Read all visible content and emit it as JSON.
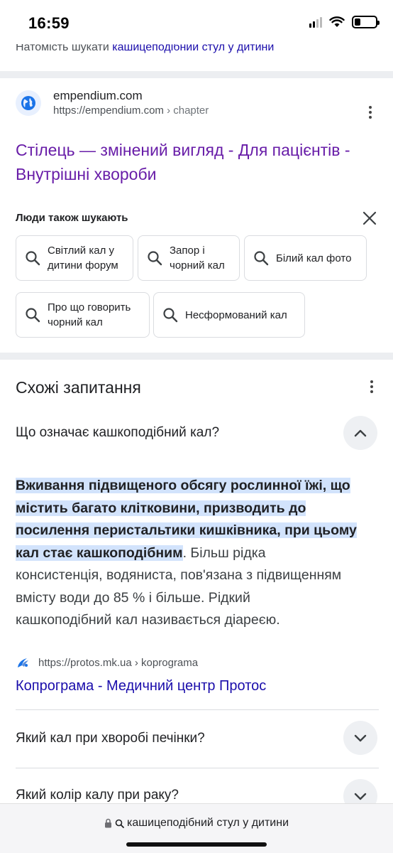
{
  "status_bar": {
    "time": "16:59"
  },
  "instead_search": {
    "prefix": "Натомість шукати",
    "link": "кашицеподібний стул у дитини"
  },
  "result": {
    "site_name": "empendium.com",
    "url": "https://empendium.com",
    "crumb": "› chapter",
    "title": "Стілець — змінений вигляд - Для пацієнтів - Внутрішні хвороби"
  },
  "people_also_search": {
    "heading": "Люди також шукають",
    "chips": [
      {
        "line1": "Світлий кал у",
        "line2": "дитини форум"
      },
      {
        "line1": "Запор і",
        "line2": "чорний кал"
      },
      {
        "line1": "Білий кал фото",
        "line2": ""
      },
      {
        "line1": "Про що говорить",
        "line2": "чорний кал"
      },
      {
        "line1": "Несформований кал",
        "line2": ""
      }
    ]
  },
  "related_questions": {
    "heading": "Схожі запитання",
    "q1": "Що означає кашкоподібний кал?",
    "answer_highlight_l1": "Вживання підвищеного обсягу рослинної їжі, що",
    "answer_highlight_l2": "містить багато клітковини, призводить до",
    "answer_highlight_l3": "посилення перистальтики кишківника, при цьому",
    "answer_highlight_l4": "кал стає кашкоподібним",
    "answer_rest_l4": ". Більш рідка",
    "answer_l5": "консистенція, водяниста, пов'язана з підвищенням",
    "answer_l6": "вмісту води до 85 % і більше. Рідкий",
    "answer_l7": "кашкоподібний кал називається діареєю.",
    "source_url": "https://protos.mk.ua › koprograma",
    "source_title": "Копрограма - Медичний центр Протос",
    "q2": "Який кал при хворобі печінки?",
    "q3": "Який колір калу при раку?"
  },
  "browser": {
    "url": "кашицеподібний стул у дитини"
  },
  "colors": {
    "link": "#1a0dab",
    "visited": "#681da8",
    "highlight": "#d2e3fc"
  }
}
